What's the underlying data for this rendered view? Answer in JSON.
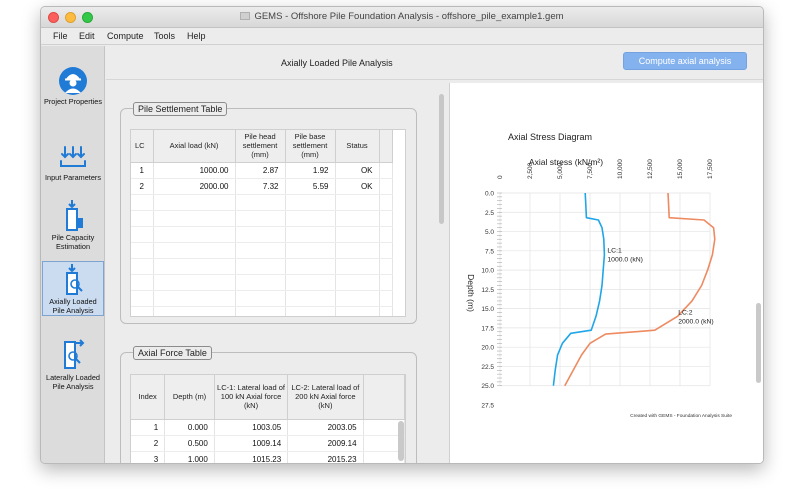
{
  "window": {
    "title": "GEMS - Offshore Pile Foundation Analysis - offshore_pile_example1.gem"
  },
  "menu": [
    "File",
    "Edit",
    "Compute",
    "Tools",
    "Help"
  ],
  "sidebar": {
    "items": [
      {
        "label": "Project Properties",
        "icon": "engineer-icon"
      },
      {
        "label": "Input Parameters",
        "icon": "loads-icon"
      },
      {
        "label": "Pile Capacity Estimation",
        "icon": "pile-capacity-icon"
      },
      {
        "label": "Axially Loaded Pile Analysis",
        "icon": "axial-pile-icon",
        "active": true
      },
      {
        "label": "Laterally Loaded Pile Analysis",
        "icon": "lateral-pile-icon"
      }
    ]
  },
  "main": {
    "title": "Axially Loaded Pile Analysis",
    "compute_label": "Compute axial analysis"
  },
  "settlement_table": {
    "title": "Pile Settlement Table",
    "headers": [
      "LC",
      "Axial load (kN)",
      "Pile head settlement (mm)",
      "Pile base settlement (mm)",
      "Status"
    ],
    "rows": [
      [
        "1",
        "1000.00",
        "2.87",
        "1.92",
        "OK"
      ],
      [
        "2",
        "2000.00",
        "7.32",
        "5.59",
        "OK"
      ]
    ]
  },
  "force_table": {
    "title": "Axial Force Table",
    "headers": [
      "Index",
      "Depth (m)",
      "LC-1: Lateral load of 100 kN Axial force (kN)",
      "LC-2: Lateral load of 200 kN Axial force (kN)"
    ],
    "rows": [
      [
        "1",
        "0.000",
        "1003.05",
        "2003.05"
      ],
      [
        "2",
        "0.500",
        "1009.14",
        "2009.14"
      ],
      [
        "3",
        "1.000",
        "1015.23",
        "2015.23"
      ]
    ]
  },
  "chart_data": {
    "type": "line",
    "title": "Axial Stress Diagram",
    "xlabel": "Axial stress (kN/m²)",
    "ylabel": "Depth (m)",
    "xlim": [
      0,
      20000
    ],
    "ylim": [
      27.5,
      0
    ],
    "x_ticks": [
      "0",
      "2,500",
      "5,000",
      "7,500",
      "10,000",
      "12,500",
      "15,000",
      "17,500"
    ],
    "y_ticks": [
      "0.0",
      "2.5",
      "5.0",
      "7.5",
      "10.0",
      "12.5",
      "15.0",
      "17.5",
      "20.0",
      "22.5",
      "25.0",
      "27.5"
    ],
    "grid": true,
    "credit": "Created with GEMS - Foundation Analysis Suite",
    "colors": {
      "lc1": "#1fa6e8",
      "lc2": "#ee8a60"
    },
    "series": [
      {
        "points": [
          [
            7100,
            0
          ],
          [
            7150,
            1.5
          ],
          [
            7200,
            3.2
          ],
          [
            8200,
            3.5
          ],
          [
            8500,
            4.5
          ],
          [
            8650,
            6
          ],
          [
            8700,
            8
          ],
          [
            8600,
            10
          ],
          [
            8500,
            12
          ],
          [
            8300,
            14
          ],
          [
            8000,
            16
          ],
          [
            7600,
            17.8
          ],
          [
            5900,
            18.2
          ],
          [
            5200,
            19.5
          ],
          [
            4800,
            21
          ],
          [
            4600,
            23
          ],
          [
            4450,
            25
          ]
        ]
      },
      {
        "points": [
          [
            14000,
            0
          ],
          [
            14050,
            1.5
          ],
          [
            14100,
            3.2
          ],
          [
            17000,
            3.5
          ],
          [
            17800,
            4.5
          ],
          [
            17900,
            6
          ],
          [
            17700,
            8
          ],
          [
            17300,
            10
          ],
          [
            16800,
            12
          ],
          [
            16000,
            14
          ],
          [
            14800,
            16
          ],
          [
            12900,
            17.8
          ],
          [
            8800,
            18.3
          ],
          [
            7500,
            19.5
          ],
          [
            6800,
            21
          ],
          [
            6100,
            23
          ],
          [
            5400,
            25
          ]
        ]
      }
    ],
    "annotations": [
      {
        "lines": [
          "LC:1",
          "1000.0 (kN)"
        ],
        "at": [
          8700,
          8
        ]
      },
      {
        "lines": [
          "LC:2",
          "2000.0 (kN)"
        ],
        "at": [
          14600,
          16
        ]
      }
    ]
  }
}
